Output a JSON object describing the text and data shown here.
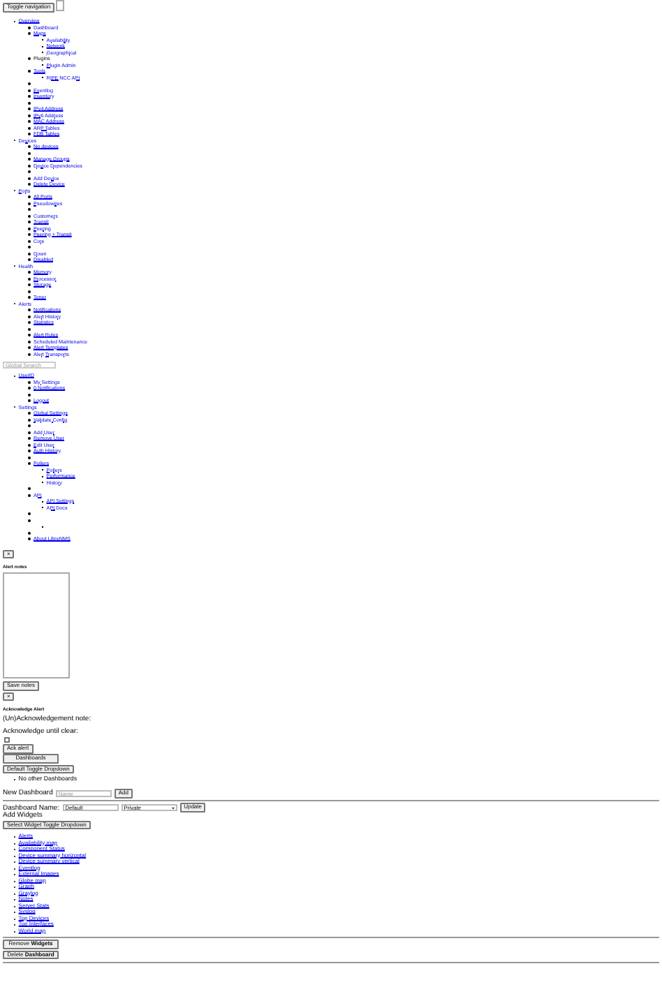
{
  "header": {
    "toggle_button": "Toggle navigation"
  },
  "nav_menu": [
    {
      "kind": "link",
      "label": "Overview",
      "children": [
        {
          "kind": "link",
          "label": "Dashboard"
        },
        {
          "kind": "link",
          "label": "Maps",
          "children": [
            {
              "kind": "link",
              "label": "Availability"
            },
            {
              "kind": "link",
              "label": "Network"
            },
            {
              "kind": "link",
              "label": "Geographical"
            }
          ]
        },
        {
          "kind": "text",
          "label": "Plugins",
          "children": [
            {
              "kind": "link",
              "label": "Plugin Admin"
            }
          ]
        },
        {
          "kind": "link",
          "label": "Tools",
          "children": [
            {
              "kind": "link",
              "label": "RIPE NCC API"
            }
          ]
        },
        {
          "kind": "divider"
        },
        {
          "kind": "link",
          "label": "Eventlog"
        },
        {
          "kind": "link",
          "label": "Inventory"
        },
        {
          "kind": "divider"
        },
        {
          "kind": "link",
          "label": "IPv4 Address"
        },
        {
          "kind": "link",
          "label": "IPv6 Address"
        },
        {
          "kind": "link",
          "label": "MAC Address"
        },
        {
          "kind": "link",
          "label": "ARP Tables"
        },
        {
          "kind": "link",
          "label": "FDB Tables"
        }
      ]
    },
    {
      "kind": "link",
      "label": "Devices",
      "children": [
        {
          "kind": "link",
          "label": "No devices"
        },
        {
          "kind": "divider"
        },
        {
          "kind": "link",
          "label": "Manage Groups"
        },
        {
          "kind": "link",
          "label": "Device Dependencies"
        },
        {
          "kind": "divider"
        },
        {
          "kind": "link",
          "label": "Add Device"
        },
        {
          "kind": "link",
          "label": "Delete Device"
        }
      ]
    },
    {
      "kind": "link",
      "label": "Ports",
      "children": [
        {
          "kind": "link",
          "label": "All Ports"
        },
        {
          "kind": "link",
          "label": "Pseudowires"
        },
        {
          "kind": "divider"
        },
        {
          "kind": "link",
          "label": "Customers"
        },
        {
          "kind": "link",
          "label": "Transit"
        },
        {
          "kind": "link",
          "label": "Peering"
        },
        {
          "kind": "link",
          "label": "Peering + Transit"
        },
        {
          "kind": "link",
          "label": "Core"
        },
        {
          "kind": "divider"
        },
        {
          "kind": "link",
          "label": "Down"
        },
        {
          "kind": "link",
          "label": "Disabled"
        }
      ]
    },
    {
      "kind": "link",
      "label": "Health",
      "children": [
        {
          "kind": "link",
          "label": "Memory"
        },
        {
          "kind": "link",
          "label": "Processor"
        },
        {
          "kind": "link",
          "label": "Storage"
        },
        {
          "kind": "divider"
        },
        {
          "kind": "link",
          "label": "Toner"
        }
      ]
    },
    {
      "kind": "link",
      "label": "Alerts",
      "children": [
        {
          "kind": "link",
          "label": "Notifications"
        },
        {
          "kind": "link",
          "label": "Alert History"
        },
        {
          "kind": "link",
          "label": "Statistics"
        },
        {
          "kind": "divider"
        },
        {
          "kind": "link",
          "label": "Alert Rules"
        },
        {
          "kind": "link",
          "label": "Scheduled Maintenance"
        },
        {
          "kind": "link",
          "label": "Alert Templates"
        },
        {
          "kind": "link",
          "label": "Alert Transports"
        }
      ]
    }
  ],
  "global_search": {
    "placeholder": "Global Search"
  },
  "user_menu": [
    {
      "kind": "link",
      "label": "UserID",
      "children": [
        {
          "kind": "link",
          "label": "My Settings"
        },
        {
          "kind": "link",
          "label": "0 Notifications"
        },
        {
          "kind": "divider"
        },
        {
          "kind": "link",
          "label": "Logout"
        }
      ]
    },
    {
      "kind": "link",
      "label": "Settings",
      "children": [
        {
          "kind": "link",
          "label": "Global Settings"
        },
        {
          "kind": "link",
          "label": "Validate Config"
        },
        {
          "kind": "divider"
        },
        {
          "kind": "link",
          "label": "Add User"
        },
        {
          "kind": "link",
          "label": "Remove User"
        },
        {
          "kind": "link",
          "label": "Edit User"
        },
        {
          "kind": "link",
          "label": "Auth History"
        },
        {
          "kind": "divider"
        },
        {
          "kind": "link",
          "label": "Pollers",
          "children": [
            {
              "kind": "link",
              "label": "Pollers"
            },
            {
              "kind": "link",
              "label": "Performance"
            },
            {
              "kind": "link",
              "label": "History"
            }
          ]
        },
        {
          "kind": "divider"
        },
        {
          "kind": "link",
          "label": "API",
          "children": [
            {
              "kind": "link",
              "label": "API Settings"
            },
            {
              "kind": "link",
              "label": "API Docs"
            }
          ]
        },
        {
          "kind": "divider"
        },
        {
          "kind": "divider",
          "children": [
            {
              "kind": "divider"
            }
          ]
        },
        {
          "kind": "divider"
        },
        {
          "kind": "link",
          "label": "About LibreNMS"
        }
      ]
    }
  ],
  "alert_notes": {
    "close_button": "×",
    "title": "Alert notes",
    "save_button": "Save notes"
  },
  "acknowledge": {
    "close_button": "×",
    "title": "Acknowledge Alert",
    "note_label": "(Un)Acknowledgement note:",
    "until_clear_label": "Acknowledge until clear:",
    "until_clear_checked": false,
    "ack_button": "Ack alert"
  },
  "dashboards": {
    "button": "Dashboards",
    "toggle_button": "Default Toggle Dropdown",
    "items": [
      "No other Dashboards"
    ]
  },
  "new_dashboard": {
    "label": "New Dashboard",
    "placeholder": "Name",
    "add_button": "Add"
  },
  "dashboard_settings": {
    "name_label": "Dashboard Name:",
    "name_value": "Default",
    "access": "Private",
    "update_button": "Update",
    "widgets_label": "Add Widgets",
    "select_button": "Select Widget Toggle Dropdown",
    "widgets": [
      "Alerts",
      "Availability map",
      "Component Status",
      "Device summary horizontal",
      "Device summary vertical",
      "Eventlog",
      "External Images",
      "Globe map",
      "Graph",
      "Graylog",
      "Notes",
      "Server Stats",
      "Syslog",
      "Top Devices",
      "Top Interfaces",
      "World map"
    ]
  },
  "actions": [
    "Remove **Widgets**",
    "Delete **Dashboard**"
  ]
}
